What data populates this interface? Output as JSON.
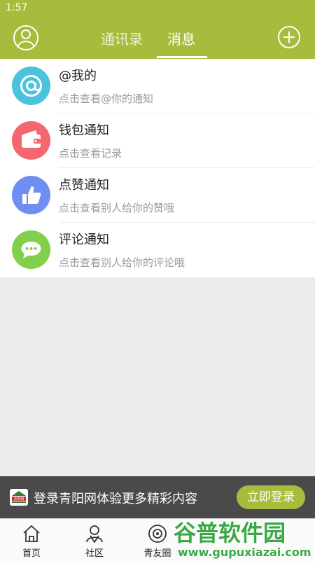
{
  "status_bar": {
    "time": "1:57"
  },
  "header": {
    "tabs": [
      {
        "label": "通讯录"
      },
      {
        "label": "消息"
      }
    ]
  },
  "messages": [
    {
      "title": "@我的",
      "subtitle": "点击查看@你的通知",
      "icon": "at-icon",
      "color": "#4cc3dc"
    },
    {
      "title": "钱包通知",
      "subtitle": "点击查看记录",
      "icon": "wallet-icon",
      "color": "#f5676e"
    },
    {
      "title": "点赞通知",
      "subtitle": "点击查看别人给你的赞哦",
      "icon": "thumbs-up-icon",
      "color": "#6f8ef2"
    },
    {
      "title": "评论通知",
      "subtitle": "点击查看别人给你的评论哦",
      "icon": "comment-icon",
      "color": "#82cf4e"
    }
  ],
  "banner": {
    "logo_text": "青阳网",
    "text": "登录青阳网体验更多精彩内容",
    "button": "立即登录"
  },
  "bottom_nav": [
    {
      "label": "首页",
      "icon": "home-icon"
    },
    {
      "label": "社区",
      "icon": "community-icon"
    },
    {
      "label": "青友圈",
      "icon": "circle-icon"
    }
  ],
  "watermark": {
    "text": "谷普软件园",
    "url": "www.gupuxiazai.com"
  },
  "colors": {
    "brand": "#a5bc3d",
    "banner_bg": "#4a4a4a"
  }
}
